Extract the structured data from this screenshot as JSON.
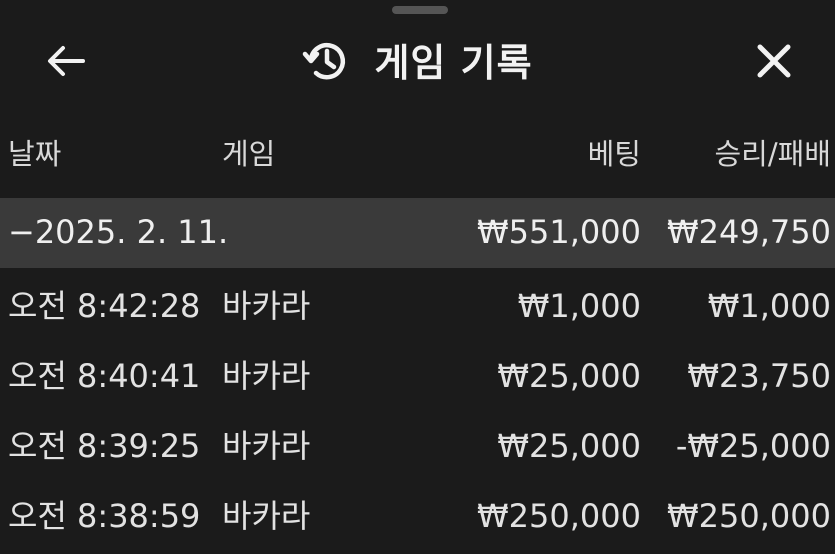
{
  "header": {
    "title": "게임 기록",
    "back_icon": "arrow-left-icon",
    "history_icon": "history-icon",
    "close_icon": "close-icon"
  },
  "columns": {
    "date": "날짜",
    "game": "게임",
    "bet": "베팅",
    "result": "승리/패배"
  },
  "group": {
    "toggle": "−",
    "date": "2025. 2. 11.",
    "bet": "₩551,000",
    "result": "₩249,750"
  },
  "rows": [
    {
      "time": "오전 8:42:28",
      "game": "바카라",
      "bet": "₩1,000",
      "result": "₩1,000"
    },
    {
      "time": "오전 8:40:41",
      "game": "바카라",
      "bet": "₩25,000",
      "result": "₩23,750"
    },
    {
      "time": "오전 8:39:25",
      "game": "바카라",
      "bet": "₩25,000",
      "result": "-₩25,000"
    },
    {
      "time": "오전 8:38:59",
      "game": "바카라",
      "bet": "₩250,000",
      "result": "₩250,000"
    }
  ],
  "colors": {
    "background": "#1b1b1b",
    "group_row": "#3a3a3a",
    "text": "#e6e6e6"
  }
}
